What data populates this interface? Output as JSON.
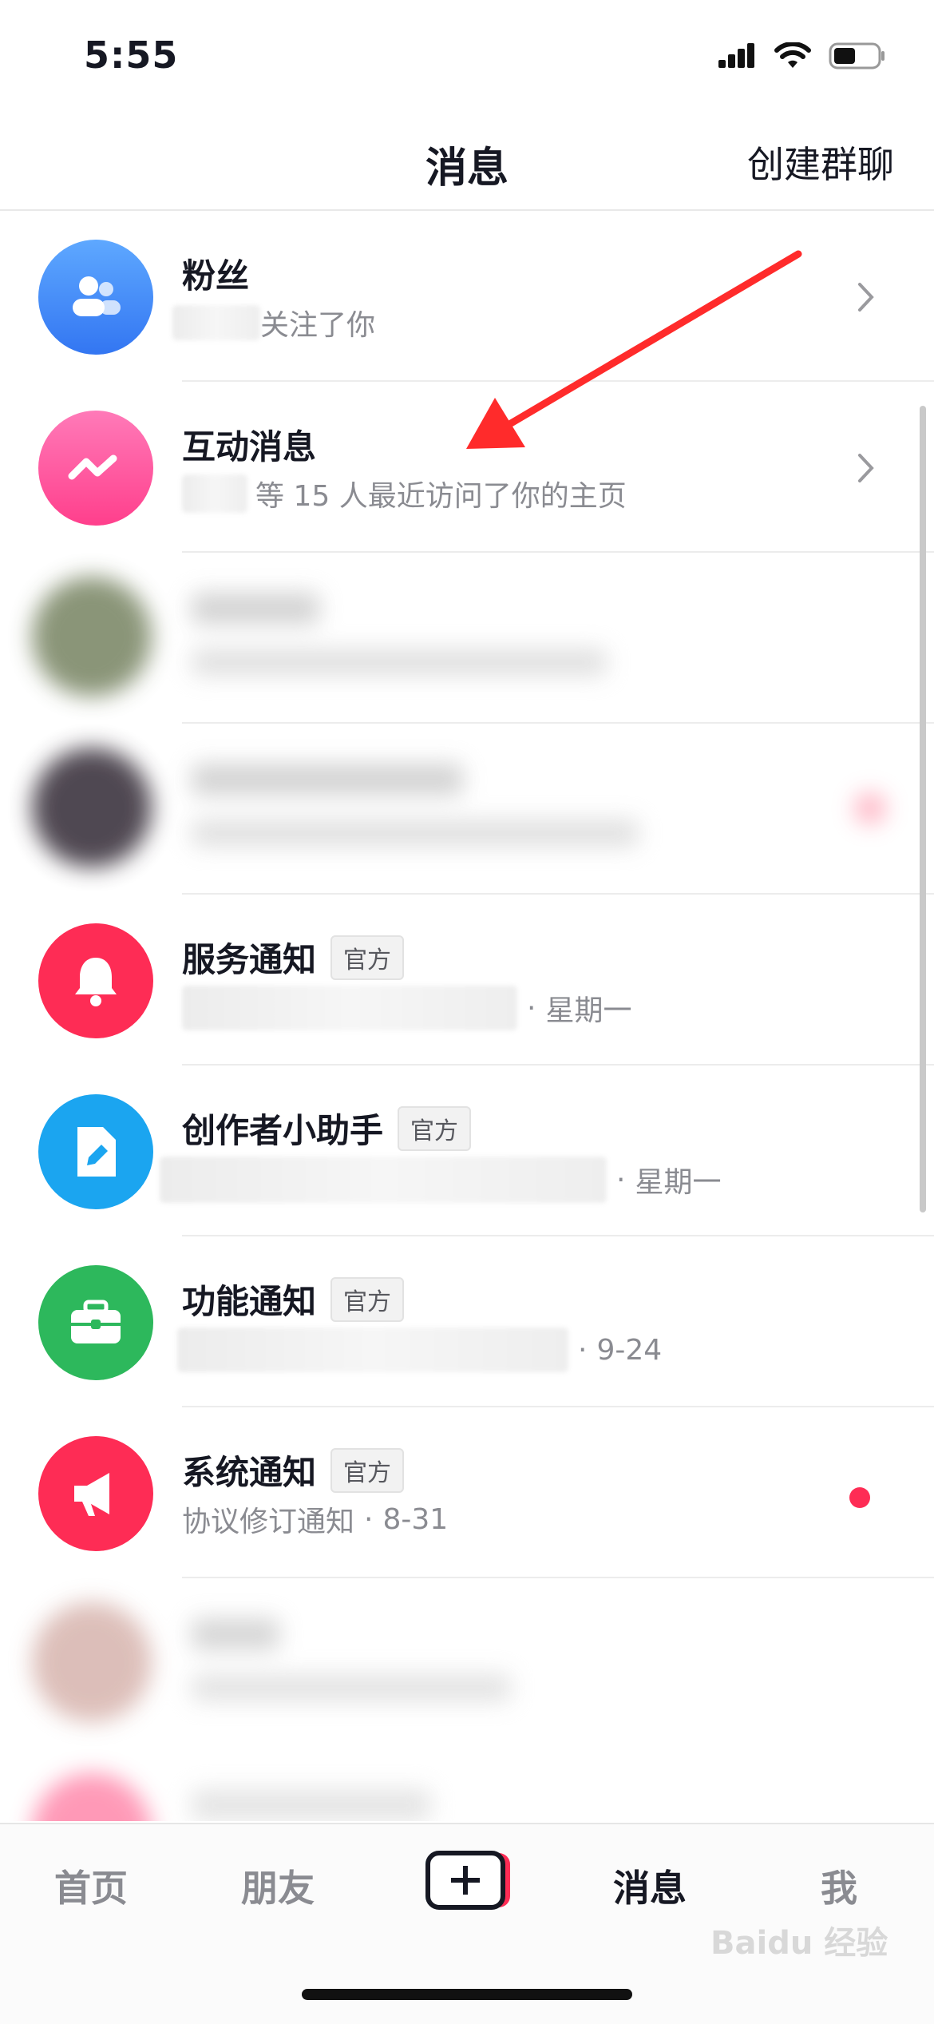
{
  "status_bar": {
    "time": "5:55"
  },
  "header": {
    "title": "消息",
    "create_group": "创建群聊"
  },
  "rows": {
    "fans": {
      "name": "粉丝",
      "subtitle": "关注了你"
    },
    "interactions": {
      "name": "互动消息",
      "subtitle": "等 15 人最近访问了你的主页"
    },
    "service": {
      "name": "服务通知",
      "tag": "官方",
      "time": "星期一"
    },
    "creator": {
      "name": "创作者小助手",
      "tag": "官方",
      "time": "星期一"
    },
    "feature": {
      "name": "功能通知",
      "tag": "官方",
      "time": "9-24"
    },
    "system": {
      "name": "系统通知",
      "tag": "官方",
      "subtitle": "协议修订通知",
      "time": "8-31"
    }
  },
  "tabs": {
    "home": "首页",
    "friends": "朋友",
    "messages": "消息",
    "me": "我"
  },
  "colors": {
    "fans_avatar": "#3d8bff",
    "interactions_avatar": "#ff4fa0",
    "service_avatar": "#fe2c55",
    "creator_avatar": "#1ba5f0",
    "feature_avatar": "#2db85c",
    "system_avatar": "#fe2c55",
    "unread_dot": "#fe2c55",
    "annotation_arrow": "#ff2b2b"
  },
  "watermark": "Baidu 经验"
}
